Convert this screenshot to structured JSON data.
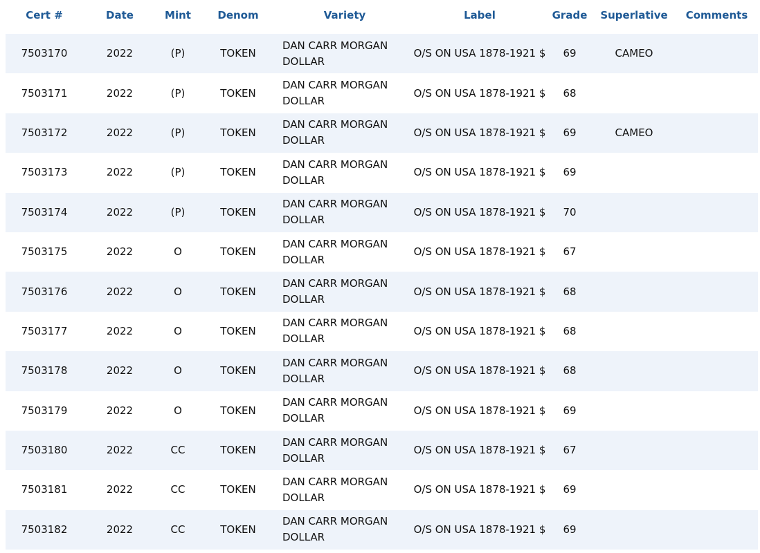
{
  "table": {
    "headers": [
      "Cert #",
      "Date",
      "Mint",
      "Denom",
      "Variety",
      "Label",
      "Grade",
      "Superlative",
      "Comments"
    ],
    "rows": [
      {
        "cert": "7503170",
        "date": "2022",
        "mint": "(P)",
        "denom": "TOKEN",
        "variety_line1": "DAN CARR MORGAN",
        "variety_line2": "DOLLAR",
        "label": "O/S ON USA 1878-1921 $",
        "grade": "69",
        "superlative": "CAMEO",
        "comments": ""
      },
      {
        "cert": "7503171",
        "date": "2022",
        "mint": "(P)",
        "denom": "TOKEN",
        "variety_line1": "DAN CARR MORGAN",
        "variety_line2": "DOLLAR",
        "label": "O/S ON USA 1878-1921 $",
        "grade": "68",
        "superlative": "",
        "comments": ""
      },
      {
        "cert": "7503172",
        "date": "2022",
        "mint": "(P)",
        "denom": "TOKEN",
        "variety_line1": "DAN CARR MORGAN",
        "variety_line2": "DOLLAR",
        "label": "O/S ON USA 1878-1921 $",
        "grade": "69",
        "superlative": "CAMEO",
        "comments": ""
      },
      {
        "cert": "7503173",
        "date": "2022",
        "mint": "(P)",
        "denom": "TOKEN",
        "variety_line1": "DAN CARR MORGAN",
        "variety_line2": "DOLLAR",
        "label": "O/S ON USA 1878-1921 $",
        "grade": "69",
        "superlative": "",
        "comments": ""
      },
      {
        "cert": "7503174",
        "date": "2022",
        "mint": "(P)",
        "denom": "TOKEN",
        "variety_line1": "DAN CARR MORGAN",
        "variety_line2": "DOLLAR",
        "label": "O/S ON USA 1878-1921 $",
        "grade": "70",
        "superlative": "",
        "comments": ""
      },
      {
        "cert": "7503175",
        "date": "2022",
        "mint": "O",
        "denom": "TOKEN",
        "variety_line1": "DAN CARR MORGAN",
        "variety_line2": "DOLLAR",
        "label": "O/S ON USA 1878-1921 $",
        "grade": "67",
        "superlative": "",
        "comments": ""
      },
      {
        "cert": "7503176",
        "date": "2022",
        "mint": "O",
        "denom": "TOKEN",
        "variety_line1": "DAN CARR MORGAN",
        "variety_line2": "DOLLAR",
        "label": "O/S ON USA 1878-1921 $",
        "grade": "68",
        "superlative": "",
        "comments": ""
      },
      {
        "cert": "7503177",
        "date": "2022",
        "mint": "O",
        "denom": "TOKEN",
        "variety_line1": "DAN CARR MORGAN",
        "variety_line2": "DOLLAR",
        "label": "O/S ON USA 1878-1921 $",
        "grade": "68",
        "superlative": "",
        "comments": ""
      },
      {
        "cert": "7503178",
        "date": "2022",
        "mint": "O",
        "denom": "TOKEN",
        "variety_line1": "DAN CARR MORGAN",
        "variety_line2": "DOLLAR",
        "label": "O/S ON USA 1878-1921 $",
        "grade": "68",
        "superlative": "",
        "comments": ""
      },
      {
        "cert": "7503179",
        "date": "2022",
        "mint": "O",
        "denom": "TOKEN",
        "variety_line1": "DAN CARR MORGAN",
        "variety_line2": "DOLLAR",
        "label": "O/S ON USA 1878-1921 $",
        "grade": "69",
        "superlative": "",
        "comments": ""
      },
      {
        "cert": "7503180",
        "date": "2022",
        "mint": "CC",
        "denom": "TOKEN",
        "variety_line1": "DAN CARR MORGAN",
        "variety_line2": "DOLLAR",
        "label": "O/S ON USA 1878-1921 $",
        "grade": "67",
        "superlative": "",
        "comments": ""
      },
      {
        "cert": "7503181",
        "date": "2022",
        "mint": "CC",
        "denom": "TOKEN",
        "variety_line1": "DAN CARR MORGAN",
        "variety_line2": "DOLLAR",
        "label": "O/S ON USA 1878-1921 $",
        "grade": "69",
        "superlative": "",
        "comments": ""
      },
      {
        "cert": "7503182",
        "date": "2022",
        "mint": "CC",
        "denom": "TOKEN",
        "variety_line1": "DAN CARR MORGAN",
        "variety_line2": "DOLLAR",
        "label": "O/S ON USA 1878-1921 $",
        "grade": "69",
        "superlative": "",
        "comments": ""
      }
    ]
  },
  "colors": {
    "header_text": "#1f5a96",
    "stripe_row": "#eef3fa",
    "plain_row": "#ffffff",
    "body_text": "#111111"
  }
}
